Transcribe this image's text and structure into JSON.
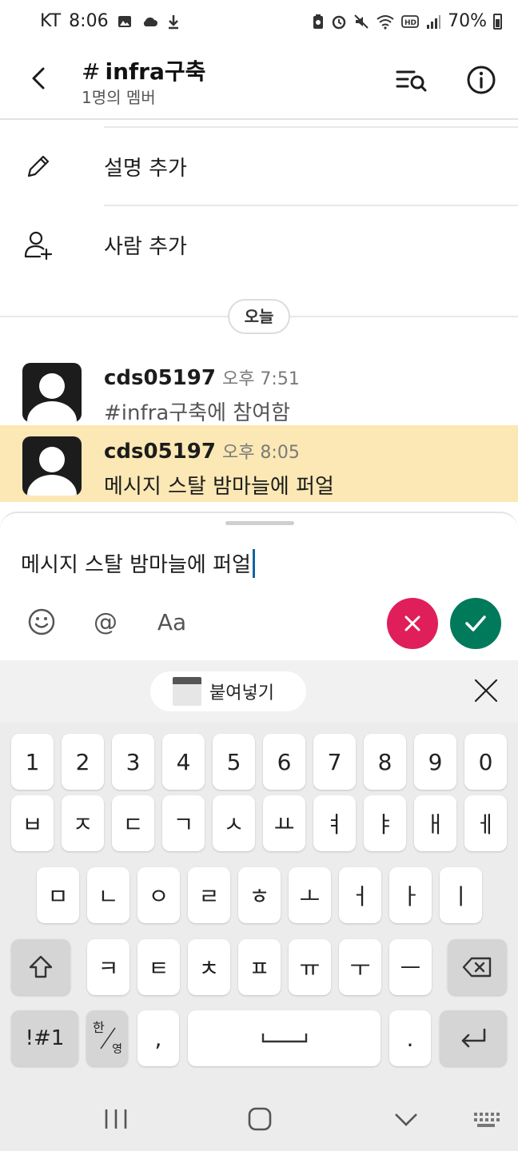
{
  "status_bar": {
    "carrier": "KT",
    "time": "8:06",
    "battery": "70%"
  },
  "header": {
    "hash": "#",
    "channel_name": "infra구축",
    "members": "1명의 멤버"
  },
  "actions": {
    "add_description": "설명 추가",
    "add_people": "사람 추가"
  },
  "day_divider": "오늘",
  "messages": [
    {
      "author": "cds05197",
      "time": "오후 7:51",
      "text": "#infra구축에 참여함"
    },
    {
      "author": "cds05197",
      "time": "오후 8:05",
      "text": "메시지 스탈 밤마늘에 퍼얼"
    }
  ],
  "composer": {
    "draft": "메시지 스탈 밤마늘에 퍼얼",
    "emoji_icon": "smile-icon",
    "mention_label": "@",
    "format_label": "Aa",
    "cancel_color": "#e01e5a",
    "send_color": "#007a5a"
  },
  "clipboard": {
    "paste_label": "붙여넣기"
  },
  "keyboard": {
    "row_numbers": [
      "1",
      "2",
      "3",
      "4",
      "5",
      "6",
      "7",
      "8",
      "9",
      "0"
    ],
    "row1": [
      "ㅂ",
      "ㅈ",
      "ㄷ",
      "ㄱ",
      "ㅅ",
      "ㅛ",
      "ㅕ",
      "ㅑ",
      "ㅐ",
      "ㅔ"
    ],
    "row2": [
      "ㅁ",
      "ㄴ",
      "ㅇ",
      "ㄹ",
      "ㅎ",
      "ㅗ",
      "ㅓ",
      "ㅏ",
      "ㅣ"
    ],
    "row3": [
      "ㅋ",
      "ㅌ",
      "ㅊ",
      "ㅍ",
      "ㅠ",
      "ㅜ",
      "ㅡ"
    ],
    "symbols_label": "!#1",
    "lang_top": "한",
    "lang_bottom": "영",
    "comma": ",",
    "period": "."
  }
}
